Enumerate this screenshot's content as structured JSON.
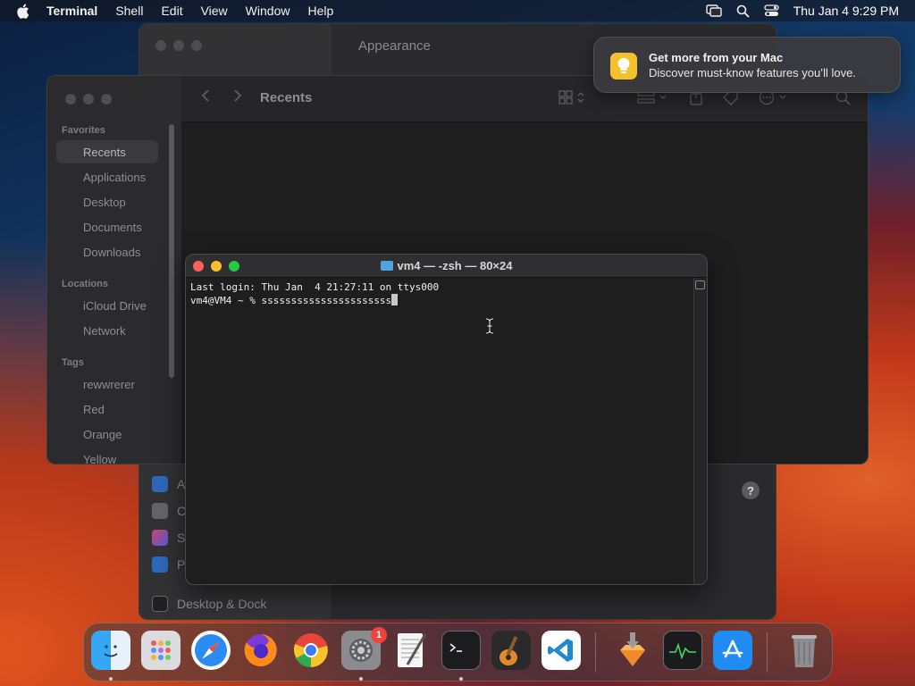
{
  "menubar": {
    "app_name": "Terminal",
    "items": [
      "Shell",
      "Edit",
      "View",
      "Window",
      "Help"
    ],
    "clock": "Thu Jan 4  9:29 PM"
  },
  "settings_window": {
    "title": "Appearance",
    "sidebar_items": [
      "A",
      "C",
      "S",
      "P",
      "Desktop & Dock"
    ],
    "help": "?"
  },
  "finder": {
    "title": "Recents",
    "sections": {
      "favorites": "Favorites",
      "locations": "Locations",
      "tags": "Tags"
    },
    "favorites": [
      "Recents",
      "Applications",
      "Desktop",
      "Documents",
      "Downloads"
    ],
    "locations": [
      "iCloud Drive",
      "Network"
    ],
    "tags": [
      "rewwrerer",
      "Red",
      "Orange",
      "Yellow"
    ]
  },
  "notification": {
    "title": "Get more from your Mac",
    "body": "Discover must-know features you’ll love."
  },
  "terminal": {
    "title": "vm4 — -zsh — 80×24",
    "line1": "Last login: Thu Jan  4 21:27:11 on ttys000",
    "prompt": "vm4@VM4 ~ % ",
    "input": "ssssssssssssssssssssss"
  },
  "dock": {
    "apps": [
      "Finder",
      "Launchpad",
      "Safari",
      "Firefox",
      "Chrome",
      "System Settings",
      "TextEdit",
      "Terminal",
      "GarageBand",
      "Visual Studio Code",
      "Installer",
      "Activity Monitor",
      "App Store",
      "Trash"
    ],
    "settings_badge": "1"
  }
}
